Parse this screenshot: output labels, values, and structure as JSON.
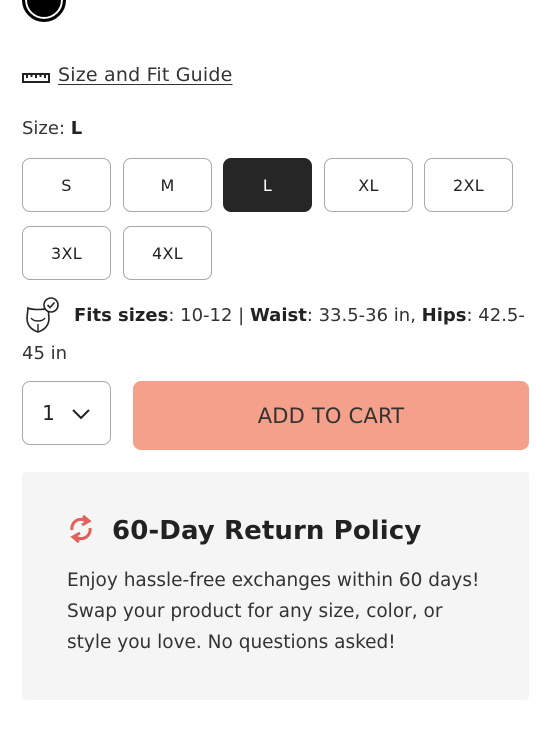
{
  "guide": {
    "link_label": "Size and Fit Guide"
  },
  "size": {
    "label": "Size:",
    "selected": "L",
    "options": [
      "S",
      "M",
      "L",
      "XL",
      "2XL",
      "3XL",
      "4XL"
    ]
  },
  "fits": {
    "fits_label": "Fits sizes",
    "fits_value": ": 10-12 | ",
    "waist_label": "Waist",
    "waist_value": ": 33.5-36 in, ",
    "hips_label": "Hips",
    "hips_value": ": 42.5-45 in"
  },
  "quantity": {
    "value": "1"
  },
  "cart": {
    "button_label": "ADD TO CART",
    "color": "#f5a08a"
  },
  "policy": {
    "title": "60-Day Return Policy",
    "text": "Enjoy hassle-free exchanges within 60 days! Swap your product for any size, color, or style you love. No questions asked!",
    "icon_color": "#e0605a"
  },
  "colors": {
    "selected_size_bg": "#262626",
    "panel_bg": "#f5f5f5"
  }
}
